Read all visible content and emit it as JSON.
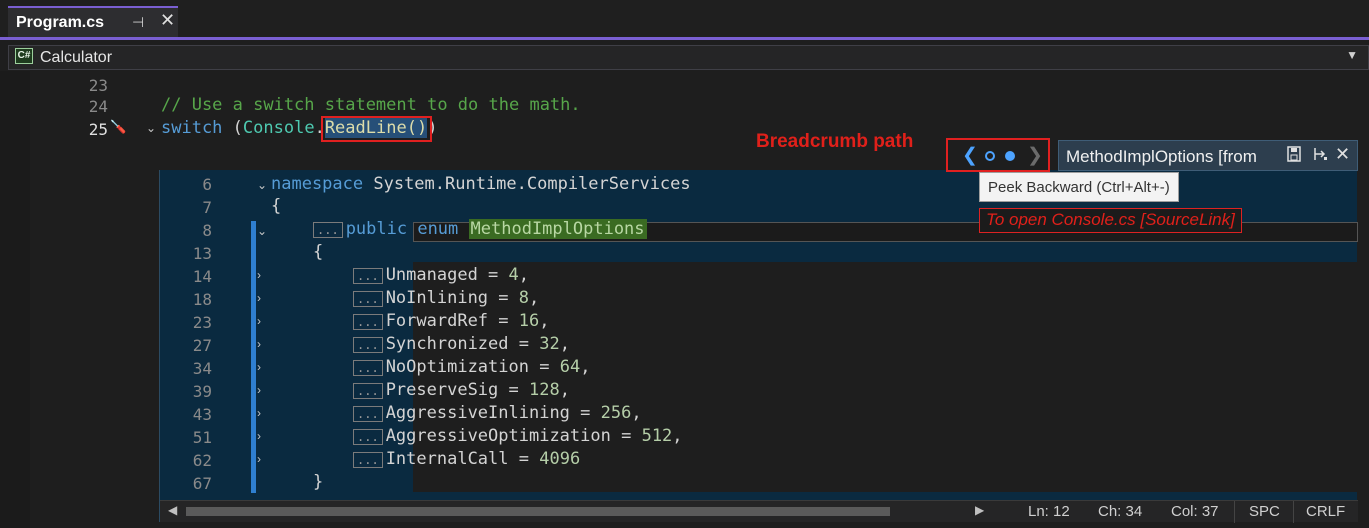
{
  "tab": {
    "title": "Program.cs",
    "pin_glyph": "⊣",
    "close_glyph": "✕"
  },
  "navbar": {
    "icon_text": "C#",
    "label": "Calculator",
    "dropdown_glyph": "▼"
  },
  "editor": {
    "lines": [
      {
        "num": "23"
      },
      {
        "num": "24",
        "comment": "// Use a switch statement to do the math."
      },
      {
        "num": "25",
        "kw": "switch",
        "open": " (",
        "type": "Console",
        "dot": ".",
        "method": "ReadLine",
        "call": "()",
        "close": ")"
      }
    ],
    "icons": {
      "fold": "⌄",
      "screwdriver": "🪛"
    }
  },
  "peek": {
    "title": "MethodImplOptions [from",
    "lines": [
      {
        "num": "6",
        "kw": "namespace",
        "text": " System.Runtime.CompilerServices"
      },
      {
        "num": "7",
        "text": "{"
      },
      {
        "num": "8",
        "kw": "public enum",
        "type": "MethodImplOptions",
        "collapsed": "..."
      },
      {
        "num": "13",
        "text": "{"
      },
      {
        "num": "14",
        "name": "Unmanaged",
        "value": "4",
        "sep": ","
      },
      {
        "num": "18",
        "name": "NoInlining",
        "value": "8",
        "sep": ","
      },
      {
        "num": "23",
        "name": "ForwardRef",
        "value": "16",
        "sep": ","
      },
      {
        "num": "27",
        "name": "Synchronized",
        "value": "32",
        "sep": ","
      },
      {
        "num": "34",
        "name": "NoOptimization",
        "value": "64",
        "sep": ","
      },
      {
        "num": "39",
        "name": "PreserveSig",
        "value": "128",
        "sep": ","
      },
      {
        "num": "43",
        "name": "AggressiveInlining",
        "value": "256",
        "sep": ","
      },
      {
        "num": "51",
        "name": "AggressiveOptimization",
        "value": "512",
        "sep": ","
      },
      {
        "num": "62",
        "name": "InternalCall",
        "value": "4096",
        "sep": ""
      },
      {
        "num": "67",
        "text": "}"
      }
    ],
    "collapsed_marker": "...",
    "equals": " = ",
    "status": {
      "ln": "Ln: 12",
      "ch": "Ch: 34",
      "col": "Col: 37",
      "spc": "SPC",
      "crlf": "CRLF"
    }
  },
  "annotations": {
    "breadcrumb": "Breadcrumb path",
    "tooltip": "Peek Backward (Ctrl+Alt+-)",
    "note": "To open Console.cs [SourceLink]"
  },
  "icons": {
    "crumb_back": "chevron-left",
    "crumb_forward": "chevron-right",
    "save": "floppy-disk",
    "promote": "promote-to-doc",
    "close": "close"
  },
  "colors": {
    "accent": "#7a5fd2",
    "annotation_red": "#e0201a",
    "peek_bg": "#0a2a40",
    "link_blue": "#4da3ff"
  }
}
